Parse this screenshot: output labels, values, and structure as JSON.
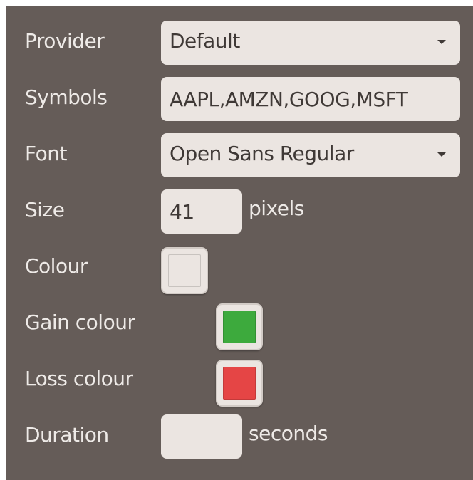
{
  "provider": {
    "label": "Provider",
    "value": "Default"
  },
  "symbols": {
    "label": "Symbols",
    "value": "AAPL,AMZN,GOOG,MSFT"
  },
  "font": {
    "label": "Font",
    "value": "Open Sans Regular"
  },
  "size": {
    "label": "Size",
    "value": "41",
    "unit": "pixels"
  },
  "colour": {
    "label": "Colour",
    "color": "#ebe5e1"
  },
  "gain_colour": {
    "label": "Gain colour",
    "color": "#3daa3d"
  },
  "loss_colour": {
    "label": "Loss colour",
    "color": "#e54545"
  },
  "duration": {
    "label": "Duration",
    "value": "",
    "unit": "seconds"
  },
  "theme": {
    "panel_bg": "#655c58",
    "control_bg": "#ebe5e1",
    "label_color": "#eeeae7"
  }
}
